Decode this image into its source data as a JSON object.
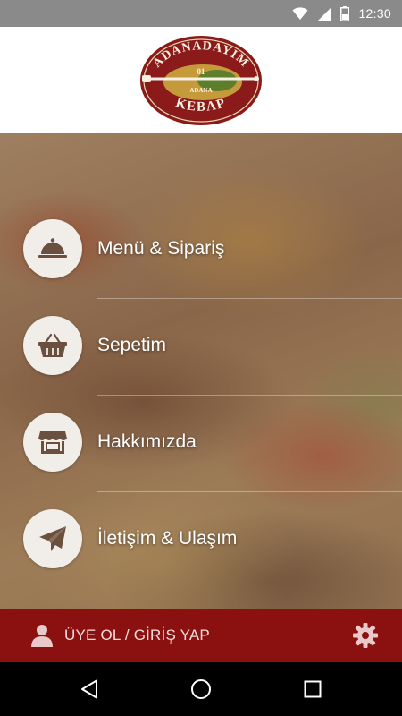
{
  "status_bar": {
    "time": "12:30",
    "icons": [
      "wifi-icon",
      "signal-icon",
      "battery-icon"
    ]
  },
  "logo": {
    "top_text": "ADANADAYIM",
    "number": "01",
    "city": "ADANA",
    "bottom_text": "KEBAP"
  },
  "menu": {
    "items": [
      {
        "label": "Menü & Sipariş",
        "icon": "cloche-icon"
      },
      {
        "label": "Sepetim",
        "icon": "basket-icon"
      },
      {
        "label": "Hakkımızda",
        "icon": "store-icon"
      },
      {
        "label": "İletişim & Ulaşım",
        "icon": "paper-plane-icon"
      }
    ]
  },
  "bottom_bar": {
    "login_label": "ÜYE OL / GİRİŞ YAP",
    "user_icon": "user-icon",
    "settings_icon": "gear-icon"
  },
  "nav_bar": {
    "buttons": [
      "back-icon",
      "home-icon",
      "recents-icon"
    ]
  },
  "colors": {
    "brand_red": "#8b1010",
    "circle_bg": "#f1ede8",
    "icon_brown": "#6b5040",
    "status_bar": "#8a8a8a"
  }
}
